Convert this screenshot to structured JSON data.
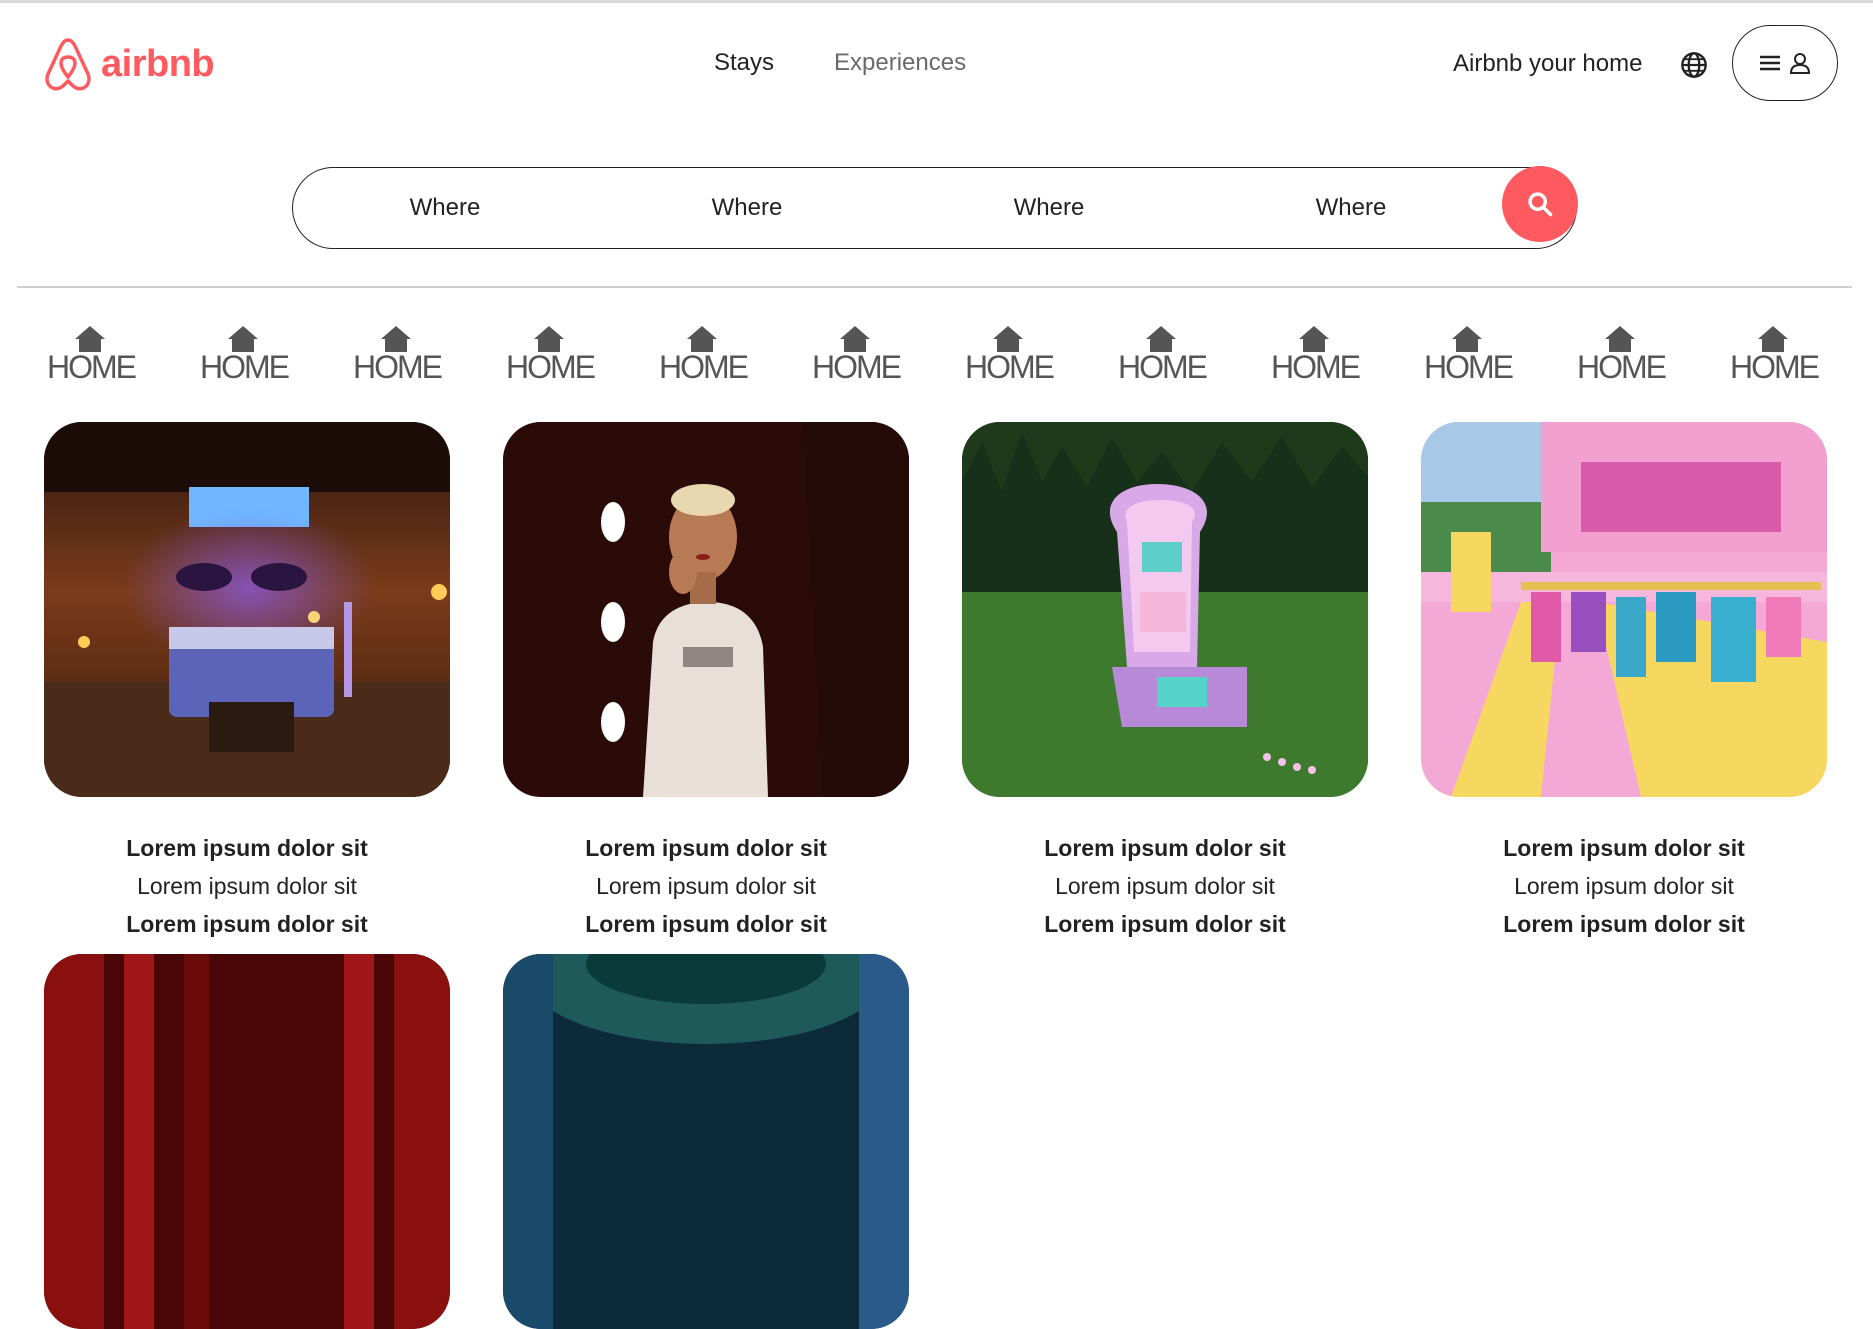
{
  "brand": {
    "name": "airbnb",
    "color": "#FF5A5F"
  },
  "nav": {
    "stays": "Stays",
    "experiences": "Experiences"
  },
  "header_right": {
    "host_label": "Airbnb your home",
    "globe_icon": "globe-icon",
    "menu_icon": "hamburger-icon",
    "user_icon": "user-icon"
  },
  "search": {
    "fields": [
      "Where",
      "Where",
      "Where",
      "Where"
    ],
    "button_icon": "search-icon"
  },
  "categories": [
    "HOME",
    "HOME",
    "HOME",
    "HOME",
    "HOME",
    "HOME",
    "HOME",
    "HOME",
    "HOME",
    "HOME",
    "HOME",
    "HOME"
  ],
  "listings": [
    {
      "title": "Lorem ipsum dolor sit",
      "subtitle": "Lorem ipsum dolor sit",
      "price": "Lorem ipsum dolor sit"
    },
    {
      "title": "Lorem ipsum dolor sit",
      "subtitle": "Lorem ipsum dolor sit",
      "price": "Lorem ipsum dolor sit"
    },
    {
      "title": "Lorem ipsum dolor sit",
      "subtitle": "Lorem ipsum dolor sit",
      "price": "Lorem ipsum dolor sit"
    },
    {
      "title": "Lorem ipsum dolor sit",
      "subtitle": "Lorem ipsum dolor sit",
      "price": "Lorem ipsum dolor sit"
    }
  ]
}
